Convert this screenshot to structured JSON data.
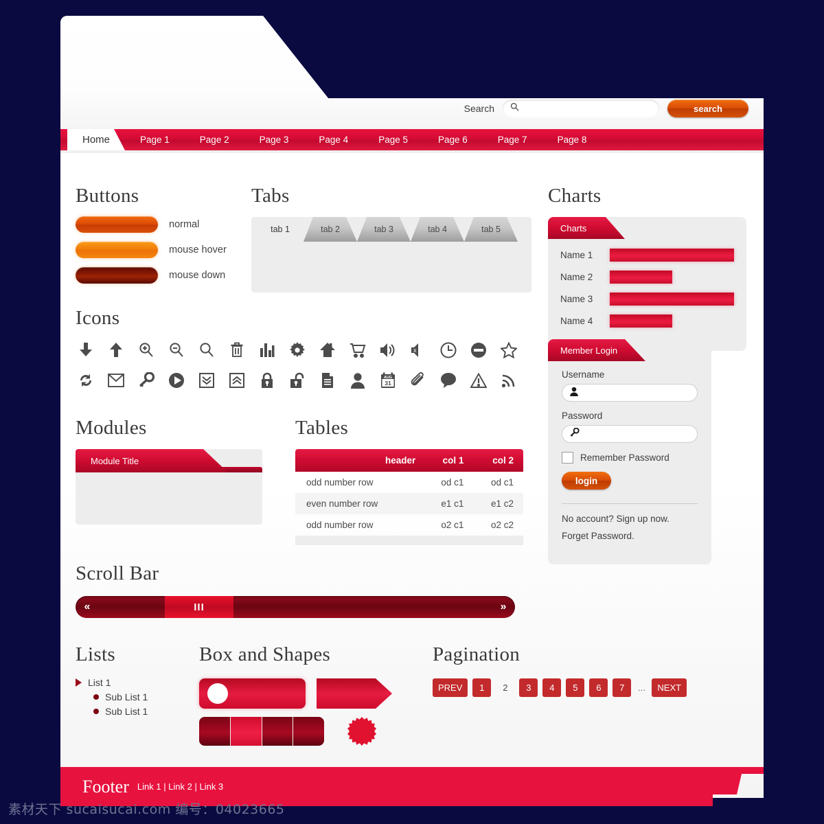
{
  "search": {
    "label": "Search",
    "value": "",
    "placeholder": "",
    "button": "search",
    "icon": "search-icon"
  },
  "nav": {
    "home": "Home",
    "items": [
      "Page 1",
      "Page 2",
      "Page 3",
      "Page 4",
      "Page 5",
      "Page 6",
      "Page 7",
      "Page 8"
    ]
  },
  "buttons": {
    "heading": "Buttons",
    "states": [
      {
        "label": "normal",
        "state": "normal"
      },
      {
        "label": "mouse hover",
        "state": "hover"
      },
      {
        "label": "mouse down",
        "state": "down"
      }
    ]
  },
  "tabs": {
    "heading": "Tabs",
    "items": [
      "tab 1",
      "tab 2",
      "tab 3",
      "tab 4",
      "tab 5"
    ],
    "active": "tab 1"
  },
  "icons": {
    "heading": "Icons",
    "row1": [
      "download-icon",
      "upload-icon",
      "zoom-in-icon",
      "zoom-out-icon",
      "search-icon",
      "trash-icon",
      "bar-chart-icon",
      "gear-icon",
      "home-icon",
      "cart-icon",
      "volume-on-icon",
      "volume-mute-icon",
      "clock-icon",
      "minus-circle-icon",
      "star-icon"
    ],
    "row2": [
      "refresh-icon",
      "mail-icon",
      "key-icon",
      "play-icon",
      "chevron-down-box-icon",
      "chevron-up-box-icon",
      "lock-closed-icon",
      "lock-open-icon",
      "document-icon",
      "user-icon",
      "calendar-icon",
      "paperclip-icon",
      "comment-icon",
      "warning-icon",
      "rss-icon"
    ],
    "calendar_month": "AUG",
    "calendar_day": "31"
  },
  "modules": {
    "heading": "Modules",
    "title": "Module Title"
  },
  "tables": {
    "heading": "Tables",
    "columns": [
      "header",
      "col 1",
      "col 2"
    ],
    "rows": [
      {
        "cells": [
          "odd number row",
          "od c1",
          "od c1"
        ],
        "parity": "odd"
      },
      {
        "cells": [
          "even number row",
          "e1 c1",
          "e1 c2"
        ],
        "parity": "even"
      },
      {
        "cells": [
          "odd number row",
          "o2 c1",
          "o2 c2"
        ],
        "parity": "odd"
      }
    ]
  },
  "scrollbar": {
    "heading": "Scroll Bar",
    "left_arrow": "«",
    "right_arrow": "»",
    "grip": "III"
  },
  "lists": {
    "heading": "Lists",
    "root": "List 1",
    "children": [
      "Sub List 1",
      "Sub List 1"
    ]
  },
  "shapes": {
    "heading": "Box and Shapes",
    "segments": 4,
    "light_segment_index": 1
  },
  "pagination": {
    "heading": "Pagination",
    "prev": "PREV",
    "next": "NEXT",
    "ellipsis": "...",
    "pages": [
      {
        "label": "1",
        "current": false
      },
      {
        "label": "2",
        "current": true
      },
      {
        "label": "3",
        "current": false
      },
      {
        "label": "4",
        "current": false
      },
      {
        "label": "5",
        "current": false
      },
      {
        "label": "6",
        "current": false
      },
      {
        "label": "7",
        "current": false
      }
    ]
  },
  "charts": {
    "heading": "Charts",
    "panel_title": "Charts"
  },
  "chart_data": {
    "type": "bar",
    "title": "Charts",
    "orientation": "horizontal",
    "categories": [
      "Name 1",
      "Name 2",
      "Name 3",
      "Name 4"
    ],
    "values": [
      100,
      50,
      100,
      50
    ],
    "xlabel": "",
    "ylabel": "",
    "xlim": [
      0,
      100
    ],
    "grid": false,
    "legend": "none"
  },
  "login": {
    "panel_title": "Member Login",
    "username_label": "Username",
    "username_value": "",
    "username_icon": "user-icon",
    "password_label": "Password",
    "password_value": "",
    "password_icon": "key-icon",
    "remember_label": "Remember Password",
    "remember_checked": false,
    "button": "login",
    "signup_link": "No account? Sign up now.",
    "forgot_link": "Forget Password."
  },
  "footer": {
    "title": "Footer",
    "links": "Link 1 | Link 2 | Link 3"
  },
  "watermark": "素材天下  sucaisucai.com  编号：04023665",
  "colors": {
    "page_background": "#0a0a41",
    "brand_red": "#e8123f",
    "brand_red_dark": "#a80826",
    "accent_orange": "#d94c06",
    "panel_gray": "#ededed",
    "pagination_red": "#c32a2c"
  }
}
